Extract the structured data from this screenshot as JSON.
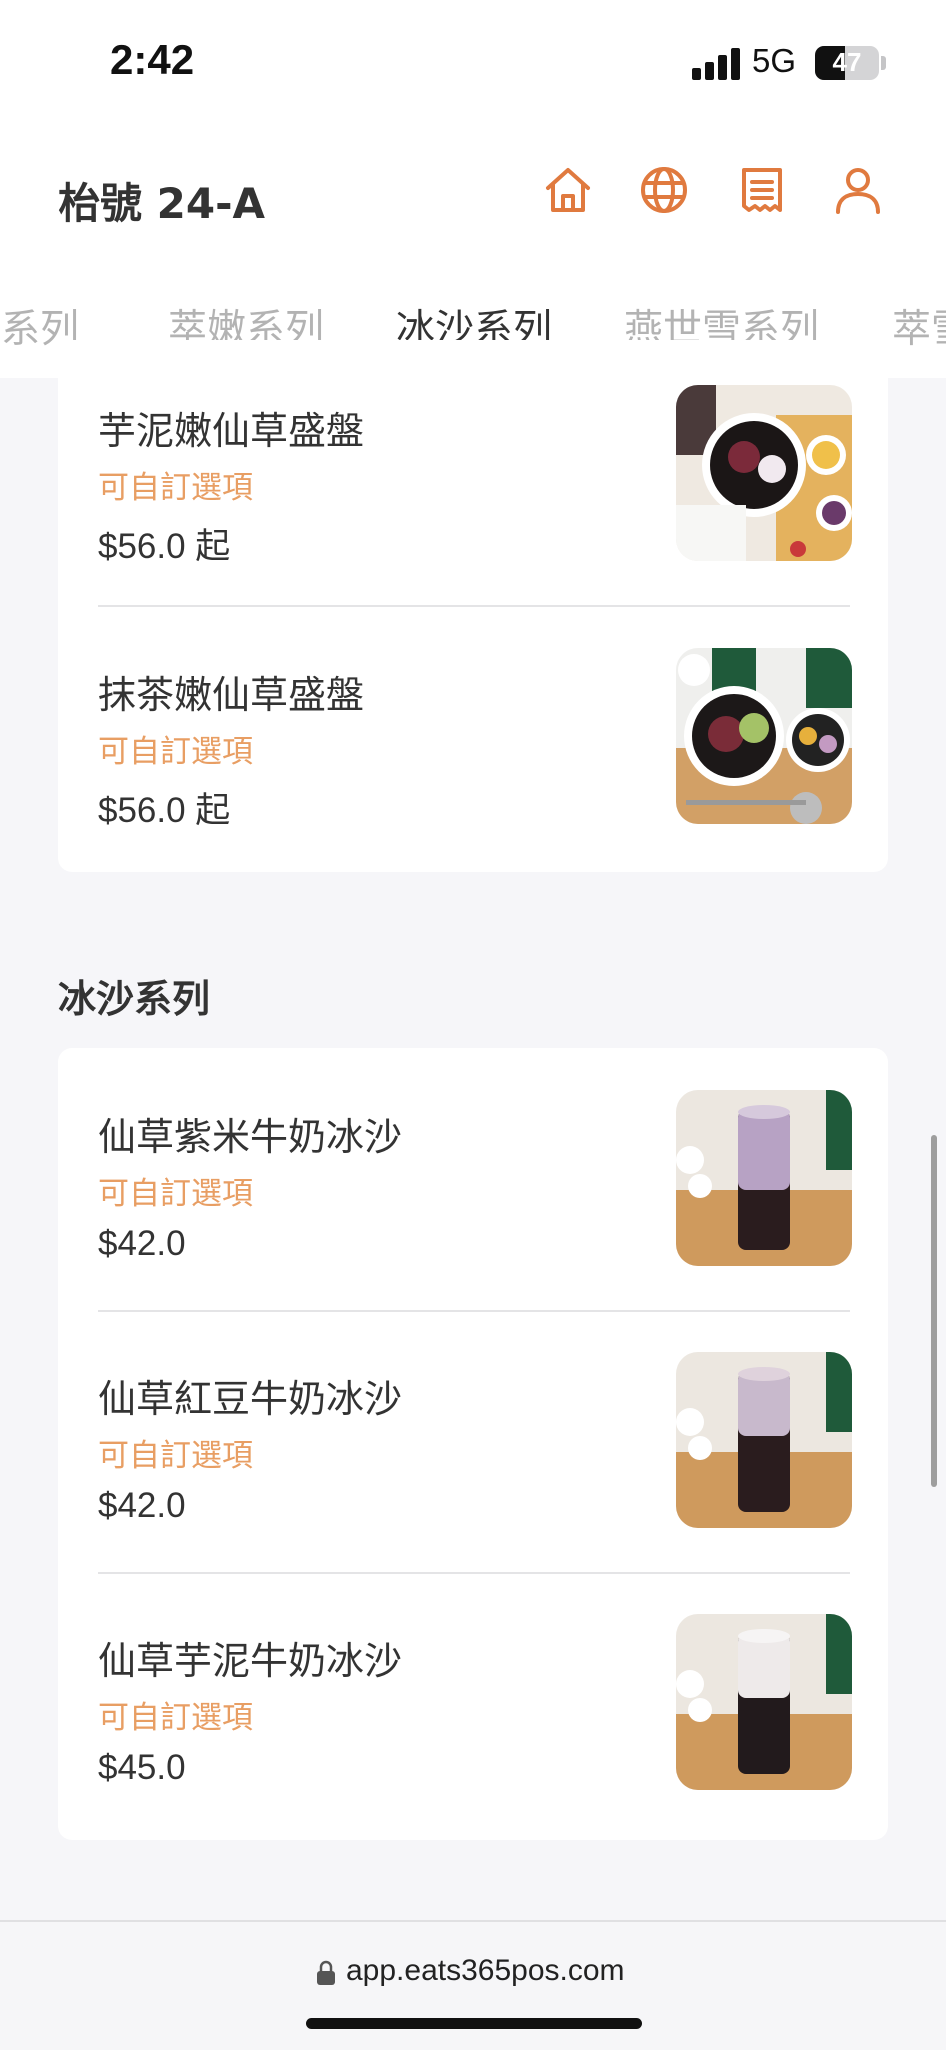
{
  "status_bar": {
    "time": "2:42",
    "network": "5G",
    "battery": "47",
    "battery_level_percent": 47
  },
  "header": {
    "title": "枱號 24-A",
    "icons": [
      "home-icon",
      "globe-icon",
      "receipt-icon",
      "user-icon"
    ],
    "accent_color": "#e07a3f"
  },
  "tabs": [
    {
      "label": "茶系列",
      "active": false
    },
    {
      "label": "萃嫩系列",
      "active": false
    },
    {
      "label": "冰沙系列",
      "active": true
    },
    {
      "label": "燕世雪系列",
      "active": false
    },
    {
      "label": "萃雪",
      "active": false
    }
  ],
  "sections": [
    {
      "title": "",
      "items": [
        {
          "name": "芋泥嫩仙草盛盤",
          "option": "可自訂選項",
          "price": "$56.0 起",
          "image": "taro-grass-jelly-platter"
        },
        {
          "name": "抹茶嫩仙草盛盤",
          "option": "可自訂選項",
          "price": "$56.0 起",
          "image": "matcha-grass-jelly-platter"
        }
      ]
    },
    {
      "title": "冰沙系列",
      "items": [
        {
          "name": "仙草紫米牛奶冰沙",
          "option": "可自訂選項",
          "price": "$42.0",
          "image": "purple-rice-smoothie"
        },
        {
          "name": "仙草紅豆牛奶冰沙",
          "option": "可自訂選項",
          "price": "$42.0",
          "image": "red-bean-smoothie"
        },
        {
          "name": "仙草芋泥牛奶冰沙",
          "option": "可自訂選項",
          "price": "$45.0",
          "image": "taro-smoothie"
        }
      ]
    }
  ],
  "browser": {
    "url": "app.eats365pos.com"
  }
}
